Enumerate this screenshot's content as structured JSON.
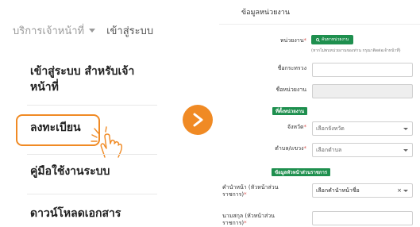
{
  "left_panel": {
    "service_menu": "บริการเจ้าหน้าที่",
    "login_link": "เข้าสู่ระบบ",
    "menu_items": [
      "เข้าสู่ระบบ สำหรับเจ้าหน้าที่",
      "ลงทะเบียน",
      "คู่มือใช้งานระบบ",
      "ดาวน์โหลดเอกสาร"
    ]
  },
  "form": {
    "title": "ข้อมูลหน่วยงาน",
    "agency_label": "หน่วยงาน",
    "search_agency_button": "ค้นหาหน่วยงาน",
    "agency_hint": "(หากไม่พบหน่วยงานของท่าน กรุณาติดต่อเจ้าหน้าที่)",
    "ministry_label": "ชื่อกระทรวง",
    "agency_name_label": "ชื่อหน่วยงาน",
    "location_section": "ที่ตั้งหน่วยงาน",
    "province_label": "จังหวัด",
    "province_placeholder": "เลือกจังหวัด",
    "subdistrict_label": "ตำบล/แขวง",
    "subdistrict_placeholder": "เลือกตำบล",
    "head_section": "ข้อมูลหัวหน้าส่วนราชการ",
    "prefix_label": "คำนำหน้า (หัวหน้าส่วนราชการ)",
    "prefix_placeholder": "เลือกคำนำหน้าชื่อ",
    "surname_label": "นามสกุล (หัวหน้าส่วนราชการ)"
  },
  "colors": {
    "accent_orange": "#f08a24",
    "primary_green": "#1e8f4e",
    "required_red": "#d9534f"
  }
}
